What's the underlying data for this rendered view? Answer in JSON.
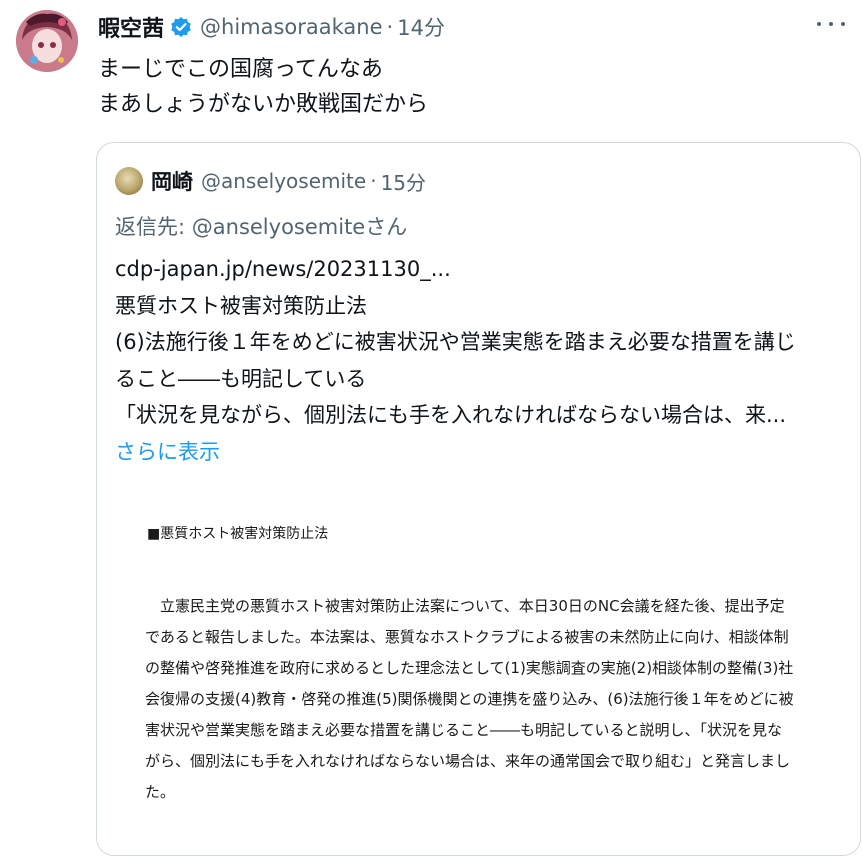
{
  "tweet": {
    "display_name": "暇空茜",
    "handle": "@himasoraakane",
    "separator": "·",
    "time": "14分",
    "avatar_icon": "user-avatar-icon",
    "verified_icon": "verified-badge-icon",
    "more_icon": "more-options-icon",
    "text_lines": [
      "まーじでこの国腐ってんなあ",
      "まあしょうがないか敗戦国だから"
    ]
  },
  "quote": {
    "display_name": "岡崎",
    "handle": "@anselyosemite",
    "separator": "·",
    "time": "15分",
    "reply_prefix": "返信先: ",
    "reply_mention": "@anselyosemiteさん",
    "body_lines": [
      "cdp-japan.jp/news/20231130_...",
      "悪質ホスト被害対策防止法",
      "(6)法施行後１年をめどに被害状況や営業実態を踏まえ必要な措置を講じ",
      "ること――も明記している",
      "「状況を見ながら、個別法にも手を入れなければならない場合は、来..."
    ],
    "show_more": "さらに表示",
    "link_color": "#1d9bf0"
  },
  "document": {
    "title": "■悪質ホスト被害対策防止法",
    "lines": [
      "　立憲民主党の悪質ホスト被害対策防止法案について、本日30日のNC会議を経た後、提出予定",
      "であると報告しました。本法案は、悪質なホストクラブによる被害の未然防止に向け、相談体制",
      "の整備や啓発推進を政府に求めるとした理念法として(1)実態調査の実施(2)相談体制の整備(3)社",
      "会復帰の支援(4)教育・啓発の推進(5)関係機関との連携を盛り込み、(6)法施行後１年をめどに被",
      "害状況や営業実態を踏まえ必要な措置を講じること――も明記していると説明し、「状況を見な",
      "がら、個別法にも手を入れなければならない場合は、来年の通常国会で取り組む」と発言しまし",
      "た。"
    ]
  },
  "colors": {
    "text": "#0f1419",
    "secondary": "#536471",
    "accent": "#1d9bf0",
    "border": "#cfd9de"
  }
}
